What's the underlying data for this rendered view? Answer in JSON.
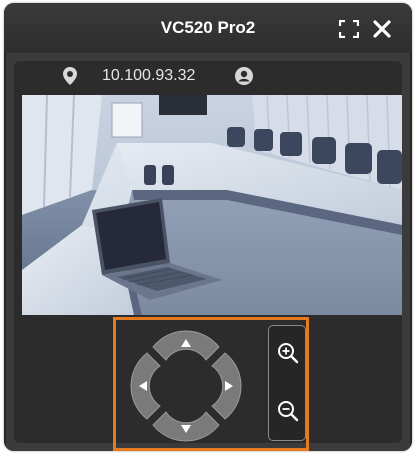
{
  "window": {
    "title": "VC520 Pro2"
  },
  "titlebar": {
    "fullscreen_icon": "fullscreen-icon",
    "close_icon": "close-icon"
  },
  "info": {
    "location_icon": "location-pin-icon",
    "ip_address": "10.100.93.32",
    "user_icon": "user-profile-icon"
  },
  "video": {
    "scene": "conference-room-with-laptop"
  },
  "controls": {
    "highlight_color": "#e57a20",
    "directions": [
      "up",
      "down",
      "left",
      "right"
    ],
    "zoom_in_icon": "zoom-in-icon",
    "zoom_out_icon": "zoom-out-icon"
  }
}
